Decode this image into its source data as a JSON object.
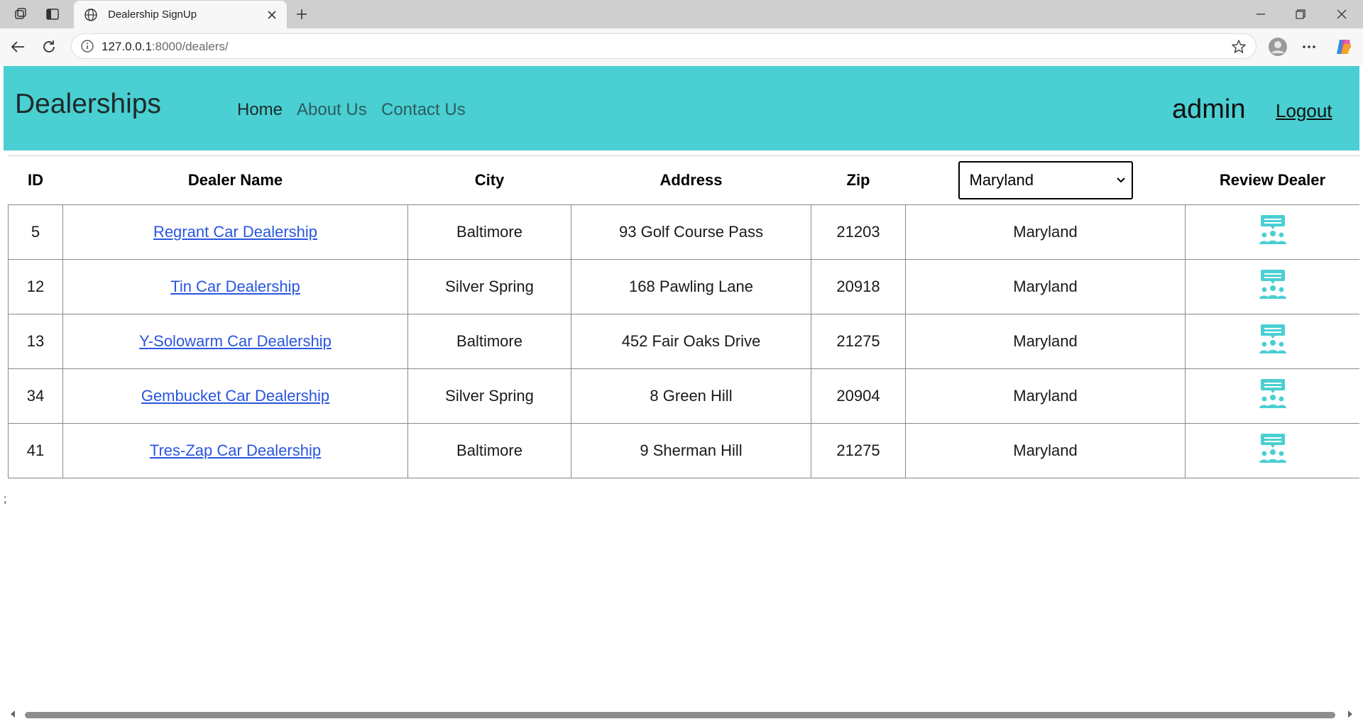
{
  "browser": {
    "tab_title": "Dealership SignUp",
    "url_host": "127.0.0.1",
    "url_path": ":8000/dealers/"
  },
  "navbar": {
    "brand": "Dealerships",
    "links": [
      "Home",
      "About Us",
      "Contact Us"
    ],
    "username": "admin",
    "logout": "Logout",
    "color": "#4acfd2"
  },
  "table": {
    "headers": {
      "id": "ID",
      "name": "Dealer Name",
      "city": "City",
      "address": "Address",
      "zip": "Zip",
      "review": "Review Dealer"
    },
    "state_filter": "Maryland",
    "rows": [
      {
        "id": "5",
        "name": "Regrant Car Dealership",
        "city": "Baltimore",
        "address": "93 Golf Course Pass",
        "zip": "21203",
        "state": "Maryland"
      },
      {
        "id": "12",
        "name": "Tin Car Dealership",
        "city": "Silver Spring",
        "address": "168 Pawling Lane",
        "zip": "20918",
        "state": "Maryland"
      },
      {
        "id": "13",
        "name": "Y-Solowarm Car Dealership",
        "city": "Baltimore",
        "address": "452 Fair Oaks Drive",
        "zip": "21275",
        "state": "Maryland"
      },
      {
        "id": "34",
        "name": "Gembucket Car Dealership",
        "city": "Silver Spring",
        "address": "8 Green Hill",
        "zip": "20904",
        "state": "Maryland"
      },
      {
        "id": "41",
        "name": "Tres-Zap Car Dealership",
        "city": "Baltimore",
        "address": "9 Sherman Hill",
        "zip": "21275",
        "state": "Maryland"
      }
    ],
    "review_icon": "review-people-icon"
  },
  "stray_text": ";"
}
